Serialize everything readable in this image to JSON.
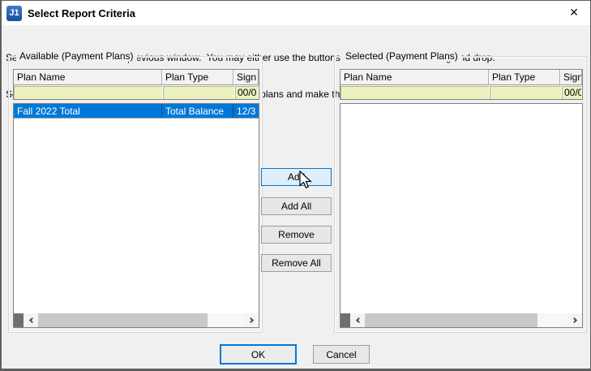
{
  "window": {
    "title": "Select Report Criteria",
    "icon_label": "J1",
    "close_glyph": "✕"
  },
  "instructions": {
    "line1": "Select items to return to the previous window.  You may either use the buttons or use the mouse to drag and drop.",
    "line2": "Select a single plan to assign to students or select multiple plans and make them available for students to select."
  },
  "available": {
    "label": "Available (Payment Plans)",
    "columns": [
      "Plan Name",
      "Plan Type",
      "Sign"
    ],
    "filter_row": [
      "",
      "",
      "00/0"
    ],
    "rows": [
      [
        "Fall 2022 Total",
        "Total Balance",
        "12/3"
      ]
    ]
  },
  "selected": {
    "label": "Selected (Payment Plans)",
    "columns": [
      "Plan Name",
      "Plan Type",
      "Sign"
    ],
    "filter_row": [
      "",
      "",
      "00/0"
    ],
    "rows": []
  },
  "transfer_buttons": {
    "add": "Add",
    "add_all": "Add All",
    "remove": "Remove",
    "remove_all": "Remove All"
  },
  "dialog_buttons": {
    "ok": "OK",
    "cancel": "Cancel"
  },
  "colors": {
    "selection_blue": "#0078D7",
    "filter_yellow": "#EDF1BD",
    "hover_fill": "#E0EEF9",
    "hover_border": "#0078D7",
    "titlebar_bg": "#FFFFFF",
    "dialog_bg": "#F0F0F0",
    "scroll_corner_dark": "#6F6F6F"
  }
}
